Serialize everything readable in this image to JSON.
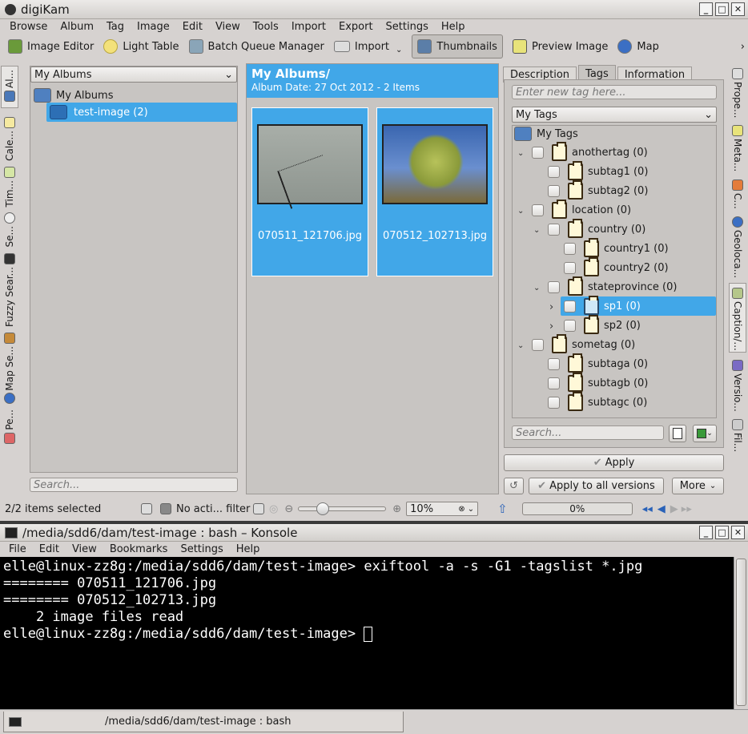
{
  "app": {
    "title": "digiKam"
  },
  "menu": [
    "Browse",
    "Album",
    "Tag",
    "Image",
    "Edit",
    "View",
    "Tools",
    "Import",
    "Export",
    "Settings",
    "Help"
  ],
  "toolbar": {
    "image_editor": "Image Editor",
    "light_table": "Light Table",
    "batch_queue": "Batch Queue Manager",
    "import": "Import",
    "thumbnails": "Thumbnails",
    "preview": "Preview Image",
    "map": "Map"
  },
  "left_tabs": [
    "Al...",
    "Cale...",
    "Tim...",
    "Se...",
    "Fuzzy Sear...",
    "Map Se...",
    "Pe..."
  ],
  "albums": {
    "combo": "My Albums",
    "root": "My Albums",
    "child": "test-image (2)",
    "search_placeholder": "Search..."
  },
  "view": {
    "title": "My Albums/",
    "subtitle": "Album Date: 27 Oct 2012 - 2 Items",
    "items": [
      {
        "name": "070511_121706.jpg"
      },
      {
        "name": "070512_102713.jpg"
      }
    ]
  },
  "right_panel": {
    "tabs": [
      "Description",
      "Tags",
      "Information"
    ],
    "new_tag_placeholder": "Enter new tag here...",
    "combo": "My Tags",
    "root": "My Tags",
    "tags": [
      "anothertag (0)",
      "subtag1 (0)",
      "subtag2 (0)",
      "location (0)",
      "country (0)",
      "country1 (0)",
      "country2 (0)",
      "stateprovince (0)",
      "sp1 (0)",
      "sp2 (0)",
      "sometag (0)",
      "subtaga (0)",
      "subtagb (0)",
      "subtagc (0)"
    ],
    "search_placeholder": "Search...",
    "apply": "Apply",
    "apply_all": "Apply to all versions",
    "more": "More"
  },
  "right_tabs": [
    "Prope...",
    "Meta...",
    "C...",
    "Geoloca...",
    "Caption/...",
    "Versio...",
    "Fil..."
  ],
  "status": {
    "selected": "2/2 items selected",
    "filter": "No acti... filter",
    "zoom": "10%",
    "progress": "0%"
  },
  "konsole": {
    "title": "/media/sdd6/dam/test-image : bash – Konsole",
    "menu": [
      "File",
      "Edit",
      "View",
      "Bookmarks",
      "Settings",
      "Help"
    ],
    "lines": [
      "elle@linux-zz8g:/media/sdd6/dam/test-image> exiftool -a -s -G1 -tagslist *.jpg",
      "======== 070511_121706.jpg",
      "======== 070512_102713.jpg",
      "    2 image files read",
      "elle@linux-zz8g:/media/sdd6/dam/test-image> "
    ],
    "tab": "/media/sdd6/dam/test-image : bash"
  }
}
